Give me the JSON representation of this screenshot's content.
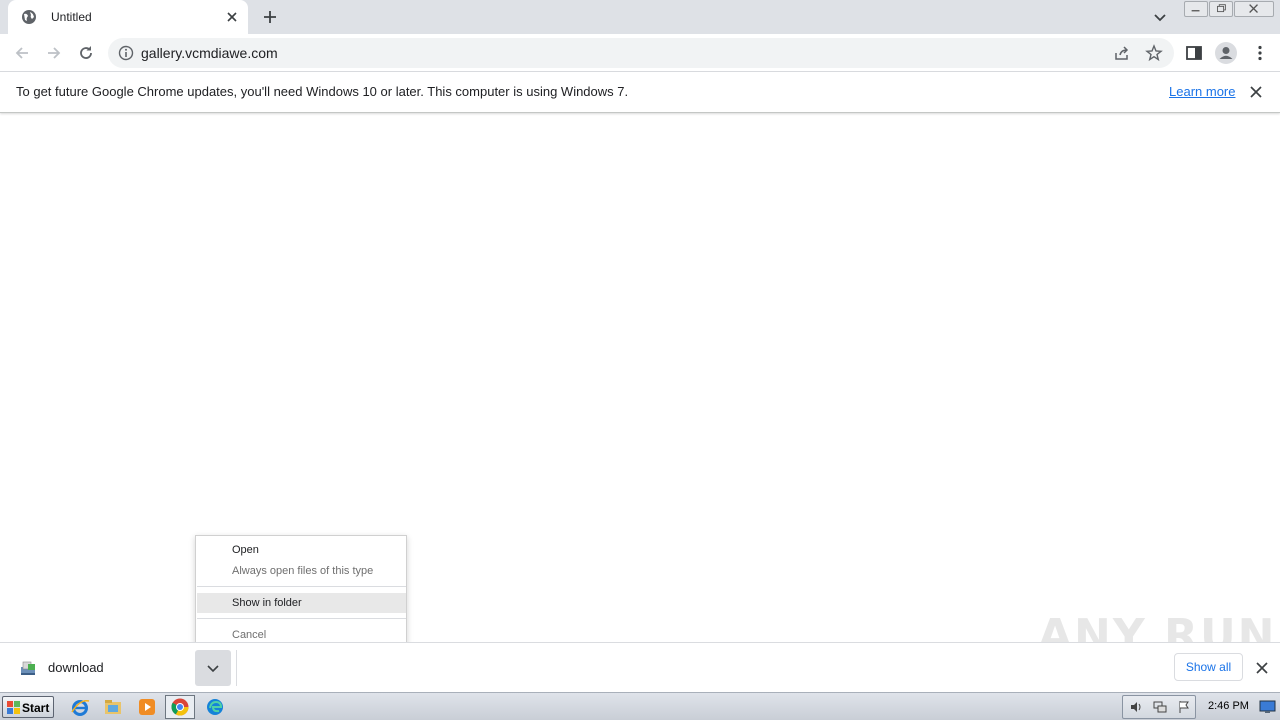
{
  "browser": {
    "tab": {
      "title": "Untitled"
    },
    "address_bar": {
      "url": "gallery.vcmdiawe.com"
    }
  },
  "infobar": {
    "message": "To get future Google Chrome updates, you'll need Windows 10 or later. This computer is using Windows 7.",
    "link_label": "Learn more"
  },
  "context_menu": {
    "items": [
      {
        "label": "Open",
        "enabled": true
      },
      {
        "label": "Always open files of this type",
        "enabled": false
      },
      {
        "label": "Show in folder",
        "enabled": true,
        "highlighted": true
      },
      {
        "label": "Cancel",
        "enabled": false
      }
    ]
  },
  "download_shelf": {
    "file_name": "download",
    "show_all_label": "Show all"
  },
  "watermark": {
    "text": "ANY RUN"
  },
  "taskbar": {
    "start_label": "Start",
    "clock": "2:46 PM",
    "pinned": [
      "internet-explorer-icon",
      "explorer-icon",
      "media-player-icon",
      "chrome-icon",
      "edge-icon"
    ]
  },
  "colors": {
    "accent": "#1a73e8",
    "tabstrip": "#dee1e6",
    "omnibox": "#f1f3f4"
  }
}
